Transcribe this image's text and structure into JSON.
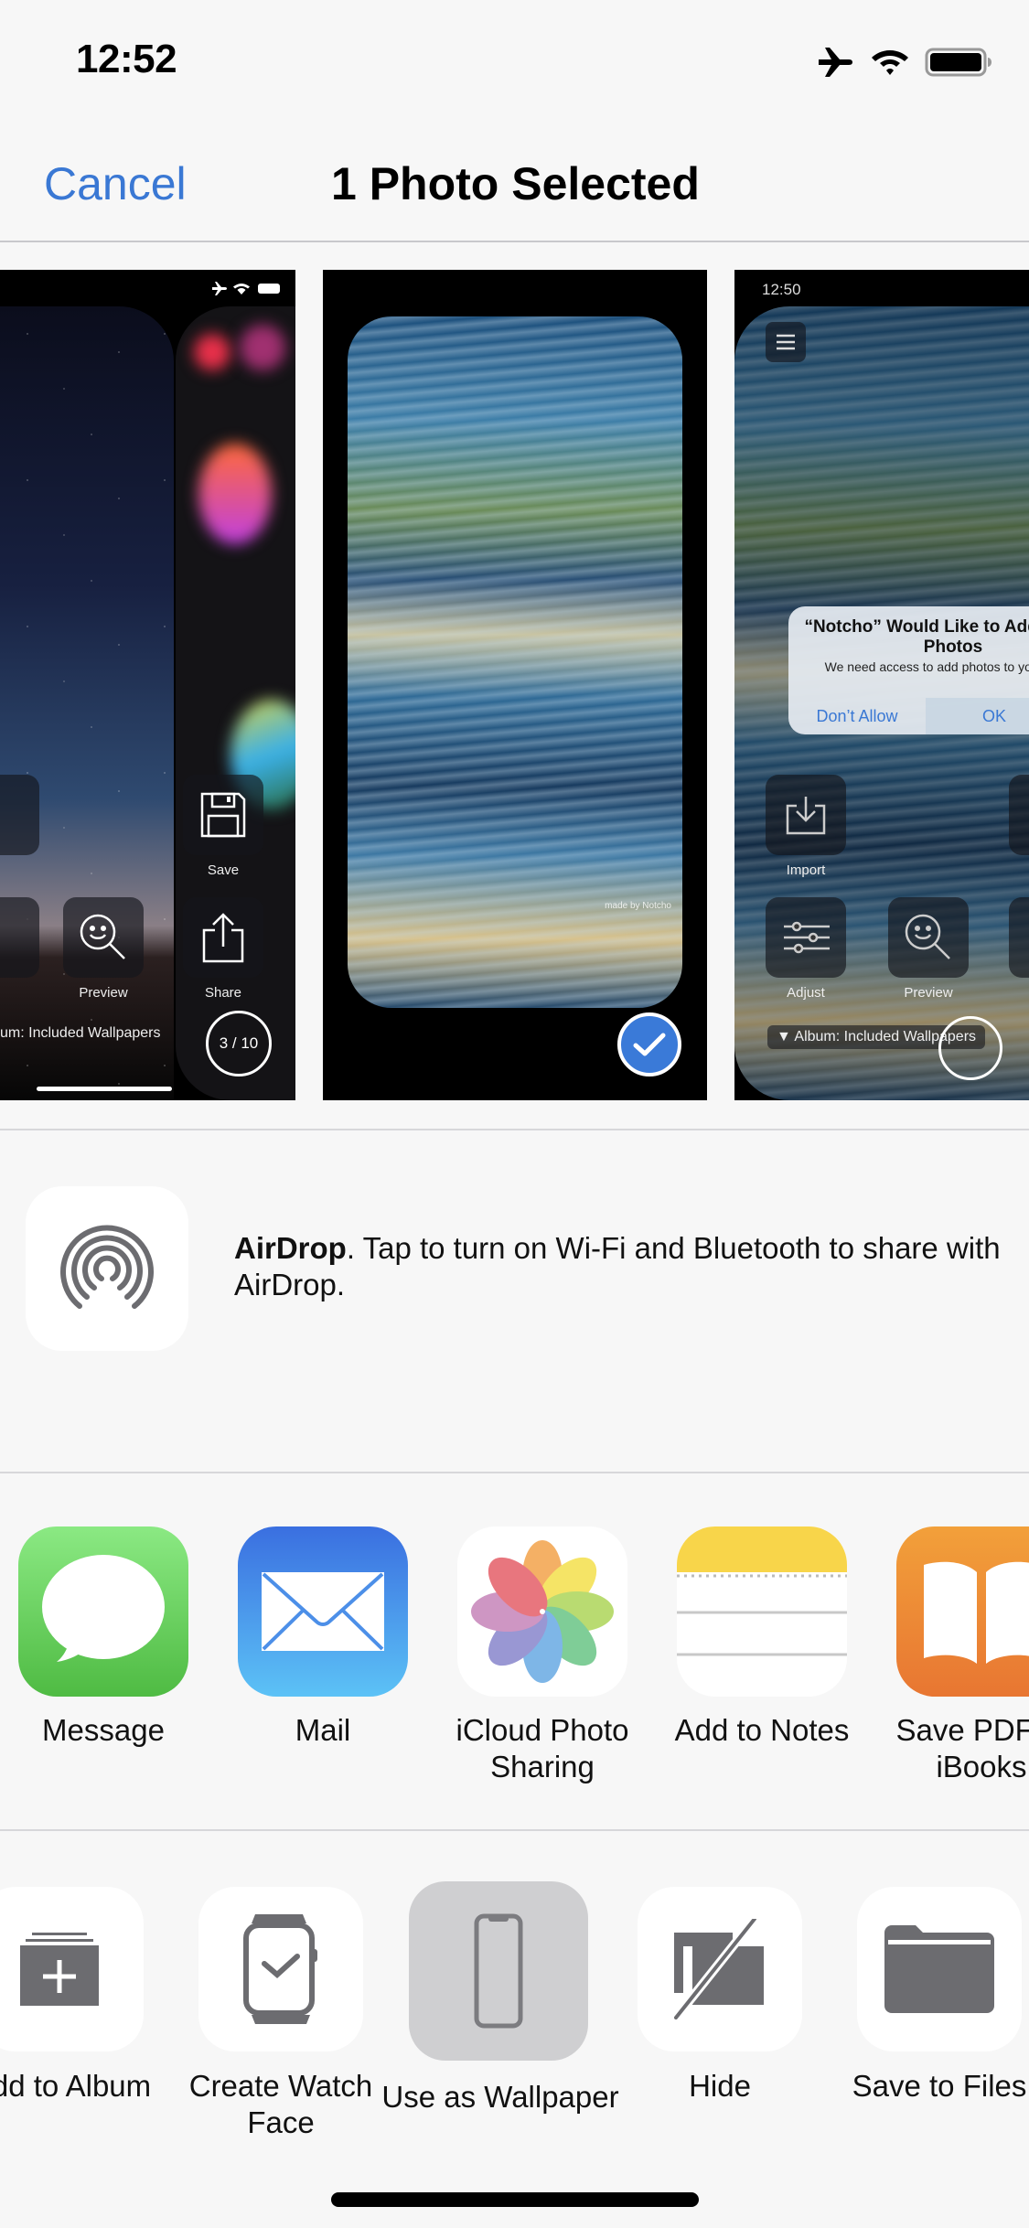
{
  "status_bar": {
    "time": "12:52",
    "icons": [
      "airplane-mode-icon",
      "wifi-icon",
      "battery-icon"
    ]
  },
  "nav": {
    "cancel_label": "Cancel",
    "title": "1 Photo Selected",
    "accent_color": "#3a78d4"
  },
  "photos": [
    {
      "name": "starry-sky-screenshot",
      "selected": false,
      "overlay": {
        "buttons": [
          "Preview",
          "Save",
          "Share"
        ],
        "album_label": "um: Included Wallpapers",
        "counter": "3 / 10"
      }
    },
    {
      "name": "ocean-waves-wallpaper",
      "selected": true,
      "watermark": "made by Notcho"
    },
    {
      "name": "notcho-app-screenshot",
      "selected": false,
      "overlay": {
        "time": "12:50",
        "dialog_title": "“Notcho” Would Like to Add to your Photos",
        "dialog_message": "We need access to add photos to your library",
        "dialog_buttons": [
          "Don’t Allow",
          "OK"
        ],
        "buttons": [
          "Import",
          "Adjust",
          "Preview"
        ],
        "album_label": "▼ Album: Included Wallpapers"
      }
    }
  ],
  "selection_badge_color": "#3a7ad8",
  "airdrop": {
    "title": "AirDrop",
    "message": ". Tap to turn on Wi-Fi and Bluetooth to share with AirDrop."
  },
  "apps": [
    {
      "label": "Message",
      "icon": "messages-icon"
    },
    {
      "label": "Mail",
      "icon": "mail-icon"
    },
    {
      "label": "iCloud Photo Sharing",
      "icon": "photos-icon"
    },
    {
      "label": "Add to Notes",
      "icon": "notes-icon"
    },
    {
      "label": "Save PDF to iBooks",
      "icon": "ibooks-icon"
    }
  ],
  "actions": [
    {
      "label": "Add to Album",
      "icon": "add-to-album-icon"
    },
    {
      "label": "Create Watch Face",
      "icon": "watch-icon"
    },
    {
      "label": "Use as Wallpaper",
      "icon": "phone-icon",
      "pressed": true
    },
    {
      "label": "Hide",
      "icon": "hide-icon"
    },
    {
      "label": "Save to Files",
      "icon": "folder-icon"
    }
  ]
}
